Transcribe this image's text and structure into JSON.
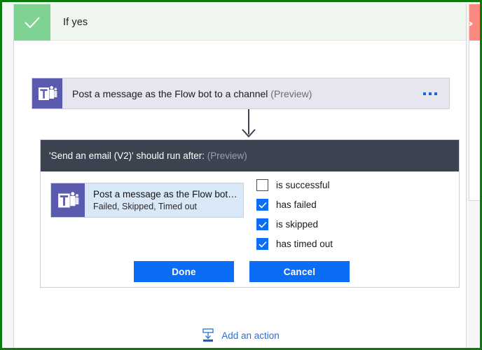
{
  "scope": {
    "title": "If yes",
    "icon": "check-icon",
    "header_bg": "#eef6ef",
    "icon_bg": "#7ed392"
  },
  "action_card": {
    "title": "Post a message as the Flow bot to a channel",
    "preview_tag": "(Preview)",
    "icon": "microsoft-teams-icon",
    "menu_icon": "ellipsis-icon",
    "bg": "#e6e6f0"
  },
  "connector": {
    "icon": "down-arrow-icon",
    "color": "#3b4350"
  },
  "run_after_dialog": {
    "header_title": "'Send an email (V2)' should run after:",
    "header_preview": "(Preview)",
    "header_bg": "#3b4350",
    "selected_action": {
      "title": "Post a message as the Flow bot…",
      "subtitle": "Failed, Skipped, Timed out",
      "icon": "microsoft-teams-icon",
      "bg": "#d8e8f6"
    },
    "statuses": [
      {
        "label": "is successful",
        "checked": false
      },
      {
        "label": "has failed",
        "checked": true
      },
      {
        "label": "is skipped",
        "checked": true
      },
      {
        "label": "has timed out",
        "checked": true
      }
    ],
    "buttons": {
      "done": "Done",
      "cancel": "Cancel",
      "color": "#0b6cf5"
    }
  },
  "add_action": {
    "label": "Add an action",
    "icon": "insert-action-icon",
    "color": "#2a6fd4"
  },
  "right_card": {
    "icon": "close-x-icon",
    "header_bg": "#fa8a80",
    "inner_icon": "microsoft-teams-icon"
  }
}
